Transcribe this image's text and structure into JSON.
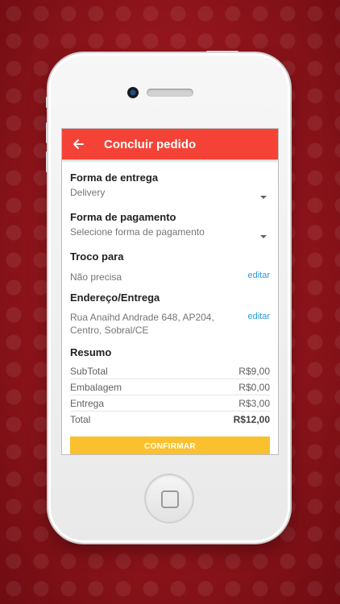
{
  "appbar": {
    "title": "Concluir pedido"
  },
  "delivery": {
    "label": "Forma de entrega",
    "value": "Delivery"
  },
  "payment": {
    "label": "Forma de pagamento",
    "value": "Selecione forma de pagamento"
  },
  "change": {
    "label": "Troco para",
    "value": "Não precisa",
    "edit_label": "editar"
  },
  "address": {
    "label": "Endereço/Entrega",
    "line1": "Rua Anaihd Andrade 648, AP204,",
    "line2": "Centro, Sobral/CE",
    "edit_label": "editar"
  },
  "summary": {
    "title": "Resumo",
    "rows": [
      {
        "label": "SubTotal",
        "value": "R$9,00"
      },
      {
        "label": "Embalagem",
        "value": "R$0,00"
      },
      {
        "label": "Entrega",
        "value": "R$3,00"
      },
      {
        "label": "Total",
        "value": "R$12,00"
      }
    ]
  },
  "confirm_label": "CONFIRMAR",
  "colors": {
    "appbar": "#f44336",
    "confirm": "#fbc02d",
    "link": "#2a9ad8",
    "background": "#a01a21"
  },
  "icons": {
    "back": "arrow-left",
    "dropdown": "caret-down",
    "home": "home-square"
  }
}
